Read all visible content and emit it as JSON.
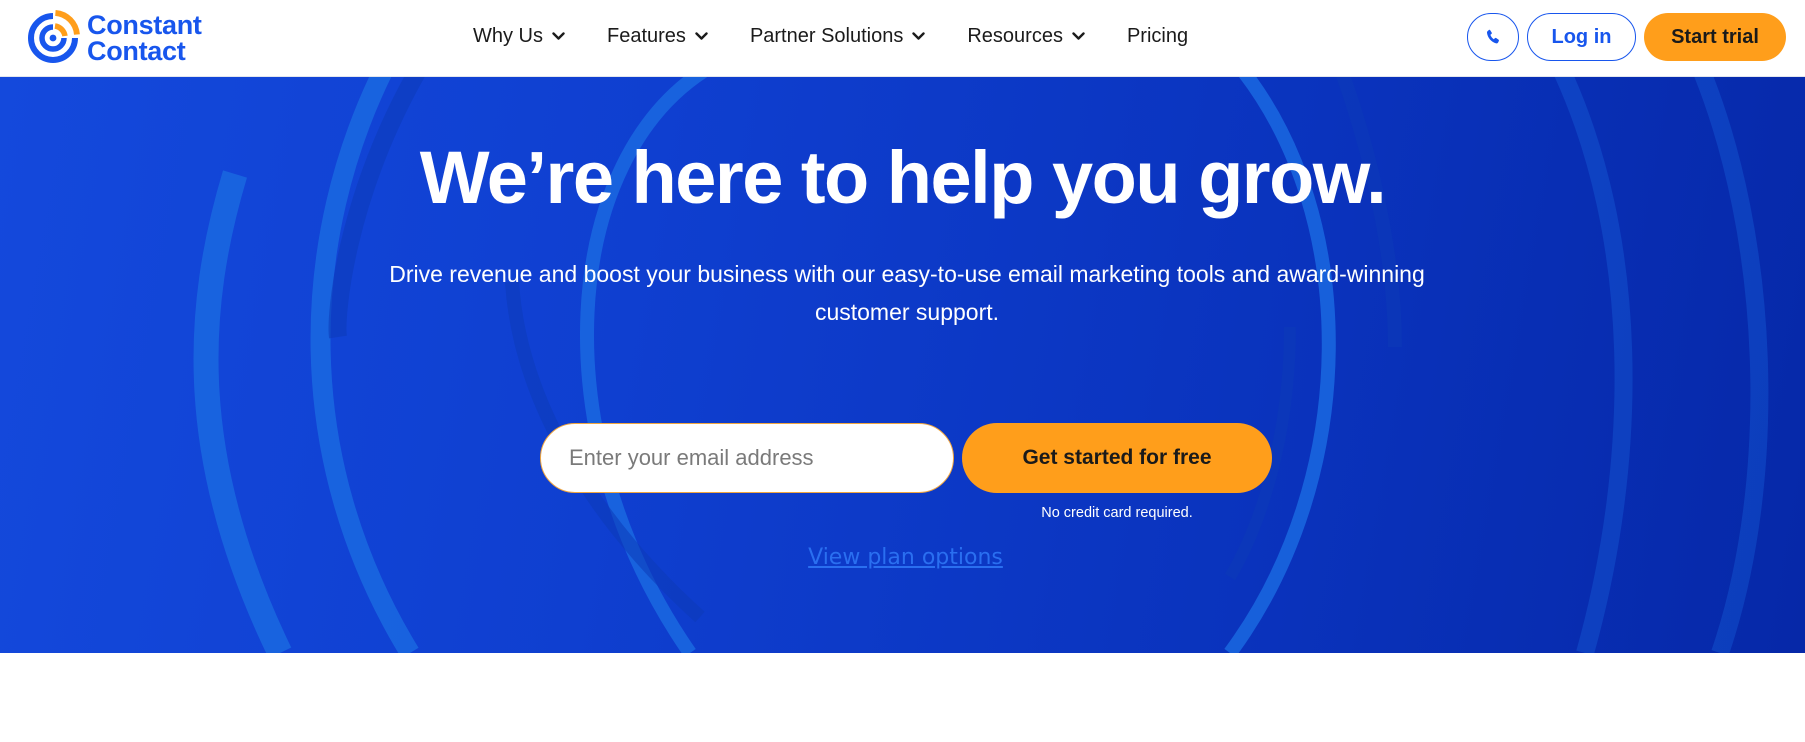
{
  "brand": {
    "name_line1": "Constant",
    "name_line2": "Contact",
    "logo_icon": "constant-contact-logo-icon",
    "colors": {
      "primary_blue": "#1856ed",
      "accent_orange": "#ff9e1b",
      "hero_blue": "#0f3fd0"
    }
  },
  "nav": {
    "items": [
      {
        "label": "Why Us",
        "has_dropdown": true,
        "icon": "chevron-down-icon"
      },
      {
        "label": "Features",
        "has_dropdown": true,
        "icon": "chevron-down-icon"
      },
      {
        "label": "Partner Solutions",
        "has_dropdown": true,
        "icon": "chevron-down-icon"
      },
      {
        "label": "Resources",
        "has_dropdown": true,
        "icon": "chevron-down-icon"
      },
      {
        "label": "Pricing",
        "has_dropdown": false
      }
    ]
  },
  "actions": {
    "phone_icon": "phone-icon",
    "login_label": "Log in",
    "trial_label": "Start trial"
  },
  "hero": {
    "title": "We’re here to help you grow.",
    "subtitle": "Drive revenue and boost your business with our easy-to-use email marketing tools and award-winning customer support.",
    "email_placeholder": "Enter your email address",
    "email_value": "",
    "cta_label": "Get started for free",
    "cta_note": "No credit card required.",
    "plan_link": "View plan options"
  }
}
